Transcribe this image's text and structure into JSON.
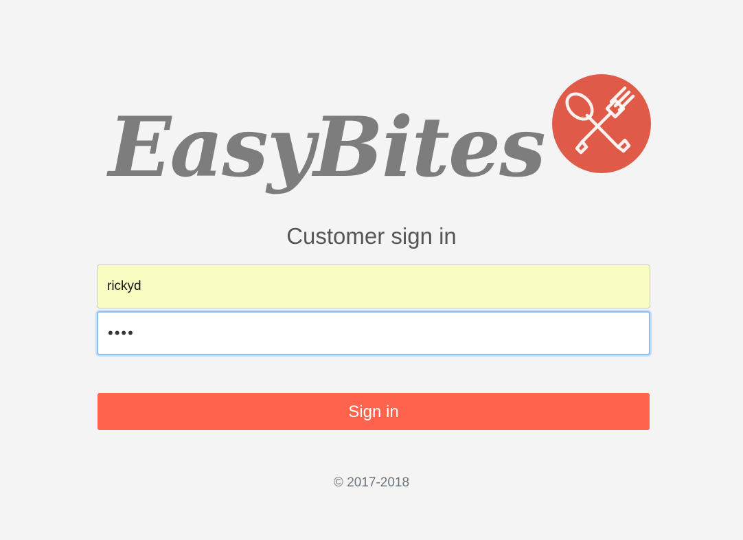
{
  "brand": {
    "name": "EasyBites",
    "logo_icon": "spoon-fork-crossed-icon",
    "logo_color": "#e05a48",
    "wordmark_color": "#7d7d7d"
  },
  "page": {
    "heading": "Customer sign in"
  },
  "form": {
    "username_value": "rickyd",
    "password_value": "abcd",
    "submit_label": "Sign in",
    "submit_color": "#fe644d"
  },
  "footer": {
    "copyright": "© 2017-2018"
  }
}
